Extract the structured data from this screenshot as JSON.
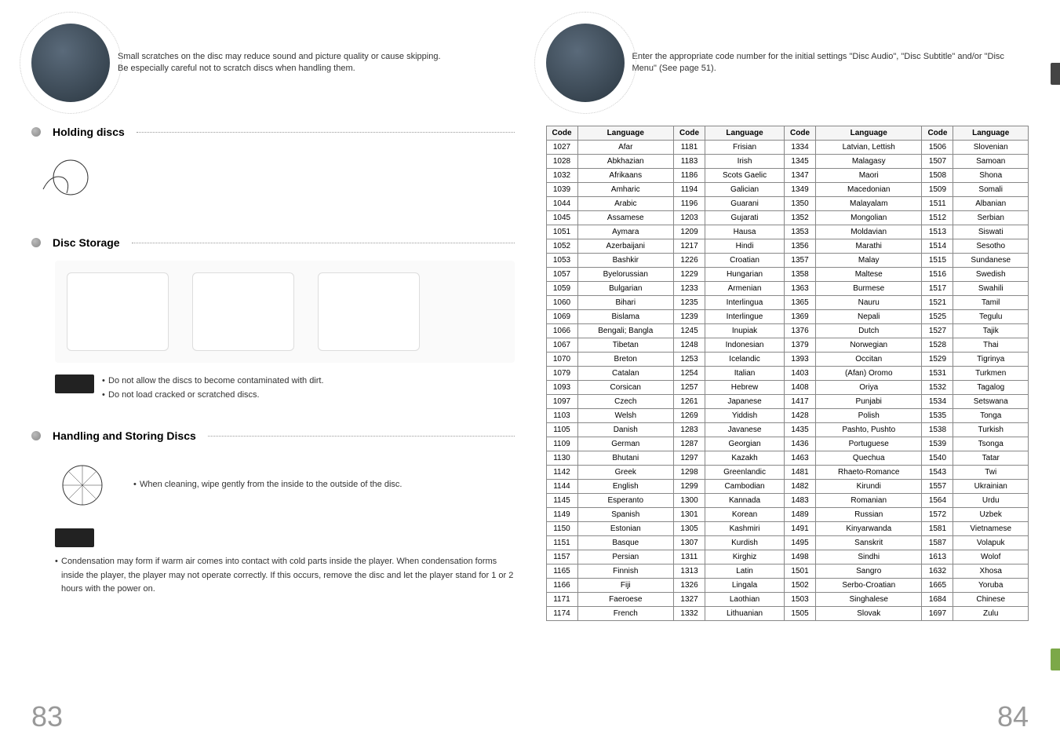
{
  "left": {
    "header_text_1": "Small scratches on the disc may reduce sound and picture quality or cause skipping.",
    "header_text_2": "Be especially careful not to scratch discs when handling them.",
    "section1_title": "Holding discs",
    "section2_title": "Disc Storage",
    "section2_note1": "Do not allow the discs to become contaminated with dirt.",
    "section2_note2": "Do not load cracked or scratched discs.",
    "section3_title": "Handling and Storing Discs",
    "section3_bullet1": "When cleaning, wipe gently from the inside to the outside of the disc.",
    "section3_bullet2": "Condensation may form if warm air comes into contact with cold parts inside the player. When condensation forms inside the player, the player may not operate correctly. If this occurs, remove the disc and let the player stand for 1 or 2 hours with the power on.",
    "page_num": "83"
  },
  "right": {
    "header_text": "Enter the appropriate code number for the initial settings \"Disc Audio\", \"Disc Subtitle\" and/or \"Disc Menu\" (See page 51).",
    "th_code": "Code",
    "th_lang": "Language",
    "rows": [
      [
        "1027",
        "Afar",
        "1181",
        "Frisian",
        "1334",
        "Latvian, Lettish",
        "1506",
        "Slovenian"
      ],
      [
        "1028",
        "Abkhazian",
        "1183",
        "Irish",
        "1345",
        "Malagasy",
        "1507",
        "Samoan"
      ],
      [
        "1032",
        "Afrikaans",
        "1186",
        "Scots Gaelic",
        "1347",
        "Maori",
        "1508",
        "Shona"
      ],
      [
        "1039",
        "Amharic",
        "1194",
        "Galician",
        "1349",
        "Macedonian",
        "1509",
        "Somali"
      ],
      [
        "1044",
        "Arabic",
        "1196",
        "Guarani",
        "1350",
        "Malayalam",
        "1511",
        "Albanian"
      ],
      [
        "1045",
        "Assamese",
        "1203",
        "Gujarati",
        "1352",
        "Mongolian",
        "1512",
        "Serbian"
      ],
      [
        "1051",
        "Aymara",
        "1209",
        "Hausa",
        "1353",
        "Moldavian",
        "1513",
        "Siswati"
      ],
      [
        "1052",
        "Azerbaijani",
        "1217",
        "Hindi",
        "1356",
        "Marathi",
        "1514",
        "Sesotho"
      ],
      [
        "1053",
        "Bashkir",
        "1226",
        "Croatian",
        "1357",
        "Malay",
        "1515",
        "Sundanese"
      ],
      [
        "1057",
        "Byelorussian",
        "1229",
        "Hungarian",
        "1358",
        "Maltese",
        "1516",
        "Swedish"
      ],
      [
        "1059",
        "Bulgarian",
        "1233",
        "Armenian",
        "1363",
        "Burmese",
        "1517",
        "Swahili"
      ],
      [
        "1060",
        "Bihari",
        "1235",
        "Interlingua",
        "1365",
        "Nauru",
        "1521",
        "Tamil"
      ],
      [
        "1069",
        "Bislama",
        "1239",
        "Interlingue",
        "1369",
        "Nepali",
        "1525",
        "Tegulu"
      ],
      [
        "1066",
        "Bengali; Bangla",
        "1245",
        "Inupiak",
        "1376",
        "Dutch",
        "1527",
        "Tajik"
      ],
      [
        "1067",
        "Tibetan",
        "1248",
        "Indonesian",
        "1379",
        "Norwegian",
        "1528",
        "Thai"
      ],
      [
        "1070",
        "Breton",
        "1253",
        "Icelandic",
        "1393",
        "Occitan",
        "1529",
        "Tigrinya"
      ],
      [
        "1079",
        "Catalan",
        "1254",
        "Italian",
        "1403",
        "(Afan) Oromo",
        "1531",
        "Turkmen"
      ],
      [
        "1093",
        "Corsican",
        "1257",
        "Hebrew",
        "1408",
        "Oriya",
        "1532",
        "Tagalog"
      ],
      [
        "1097",
        "Czech",
        "1261",
        "Japanese",
        "1417",
        "Punjabi",
        "1534",
        "Setswana"
      ],
      [
        "1103",
        "Welsh",
        "1269",
        "Yiddish",
        "1428",
        "Polish",
        "1535",
        "Tonga"
      ],
      [
        "1105",
        "Danish",
        "1283",
        "Javanese",
        "1435",
        "Pashto, Pushto",
        "1538",
        "Turkish"
      ],
      [
        "1109",
        "German",
        "1287",
        "Georgian",
        "1436",
        "Portuguese",
        "1539",
        "Tsonga"
      ],
      [
        "1130",
        "Bhutani",
        "1297",
        "Kazakh",
        "1463",
        "Quechua",
        "1540",
        "Tatar"
      ],
      [
        "1142",
        "Greek",
        "1298",
        "Greenlandic",
        "1481",
        "Rhaeto-Romance",
        "1543",
        "Twi"
      ],
      [
        "1144",
        "English",
        "1299",
        "Cambodian",
        "1482",
        "Kirundi",
        "1557",
        "Ukrainian"
      ],
      [
        "1145",
        "Esperanto",
        "1300",
        "Kannada",
        "1483",
        "Romanian",
        "1564",
        "Urdu"
      ],
      [
        "1149",
        "Spanish",
        "1301",
        "Korean",
        "1489",
        "Russian",
        "1572",
        "Uzbek"
      ],
      [
        "1150",
        "Estonian",
        "1305",
        "Kashmiri",
        "1491",
        "Kinyarwanda",
        "1581",
        "Vietnamese"
      ],
      [
        "1151",
        "Basque",
        "1307",
        "Kurdish",
        "1495",
        "Sanskrit",
        "1587",
        "Volapuk"
      ],
      [
        "1157",
        "Persian",
        "1311",
        "Kirghiz",
        "1498",
        "Sindhi",
        "1613",
        "Wolof"
      ],
      [
        "1165",
        "Finnish",
        "1313",
        "Latin",
        "1501",
        "Sangro",
        "1632",
        "Xhosa"
      ],
      [
        "1166",
        "Fiji",
        "1326",
        "Lingala",
        "1502",
        "Serbo-Croatian",
        "1665",
        "Yoruba"
      ],
      [
        "1171",
        "Faeroese",
        "1327",
        "Laothian",
        "1503",
        "Singhalese",
        "1684",
        "Chinese"
      ],
      [
        "1174",
        "French",
        "1332",
        "Lithuanian",
        "1505",
        "Slovak",
        "1697",
        "Zulu"
      ]
    ],
    "page_num": "84"
  }
}
